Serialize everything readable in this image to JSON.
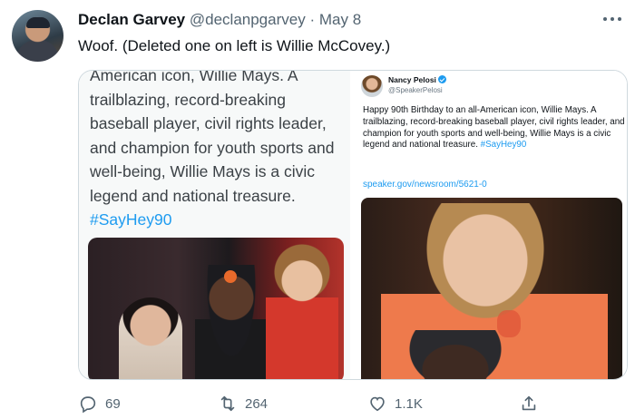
{
  "tweet": {
    "author_name": "Declan Garvey",
    "author_handle": "@declanpgarvey",
    "separator": "·",
    "date": "May 8",
    "text": "Woof. (Deleted one on left is Willie McCovey.)"
  },
  "media": {
    "left": {
      "text_lines": [
        "American icon, Willie Mays. A",
        "trailblazing, record-breaking",
        "baseball player, civil rights leader,",
        "and champion for youth sports and",
        "well-being, Willie Mays is a civic",
        "legend and national treasure."
      ],
      "hashtag": "#SayHey90"
    },
    "right": {
      "name": "Nancy Pelosi",
      "handle": "@SpeakerPelosi",
      "text": "Happy 90th Birthday to an all-American icon, Willie Mays. A trailblazing, record-breaking baseball player, civil rights leader, and champion for youth sports and well-being, Willie Mays is a civic legend and national treasure. ",
      "hashtag": "#SayHey90",
      "link": "speaker.gov/newsroom/5621-0"
    }
  },
  "actions": {
    "reply_count": "69",
    "retweet_count": "264",
    "like_count": "1.1K"
  },
  "icons": {
    "more": "more-icon",
    "reply": "reply-icon",
    "retweet": "retweet-icon",
    "like": "heart-icon",
    "share": "share-icon",
    "verified": "verified-icon"
  },
  "colors": {
    "link_blue": "#1d9bf0",
    "secondary_text": "#536471"
  }
}
